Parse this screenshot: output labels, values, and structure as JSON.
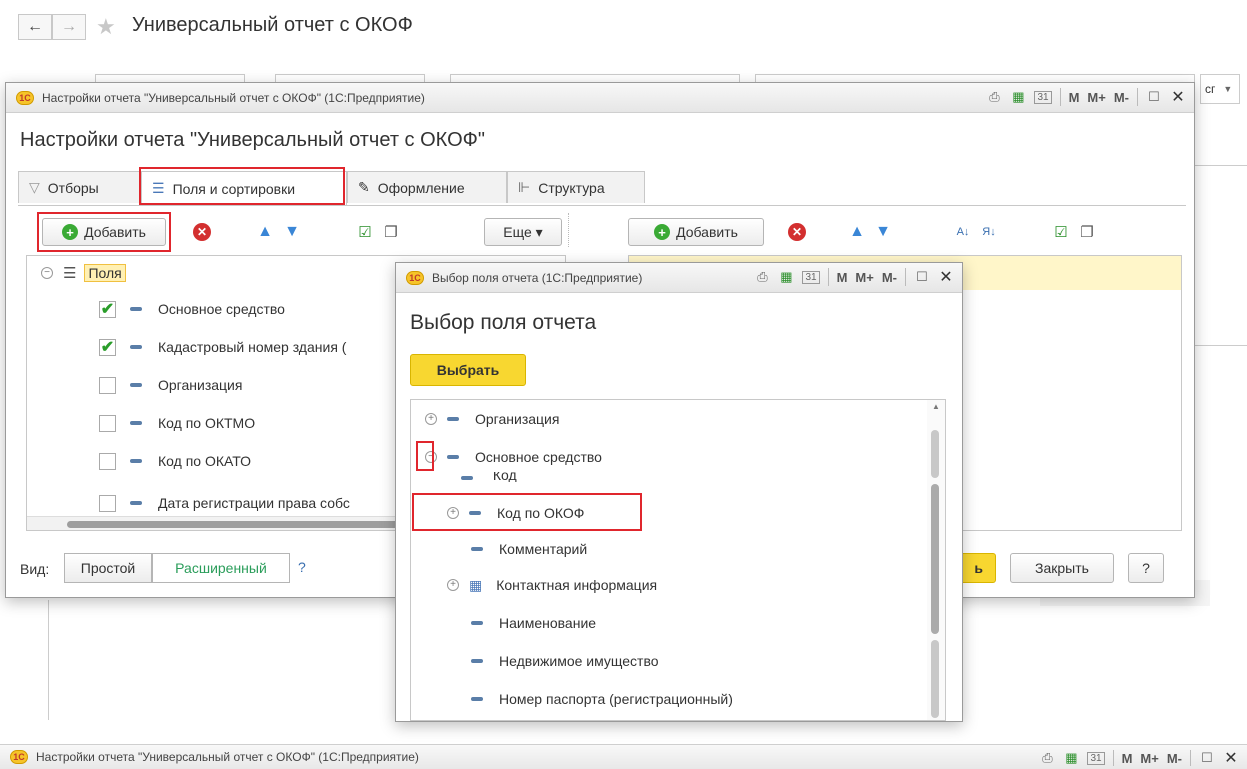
{
  "main_window": {
    "title": "Универсальный отчет с ОКОФ",
    "back_icon": "←",
    "forward_icon": "→",
    "star_icon": "★",
    "partial_right_text": "сг"
  },
  "settings_dialog": {
    "window_title": "Настройки отчета \"Универсальный отчет с ОКОФ\"  (1С:Предприятие)",
    "heading": "Настройки отчета \"Универсальный отчет с ОКОФ\"",
    "logo_text": "1С",
    "tabs": [
      "Отборы",
      "Поля и сортировки",
      "Оформление",
      "Структура"
    ],
    "tab_icons": [
      "funnel-icon",
      "fields-sort-icon",
      "brush-icon",
      "structure-icon"
    ],
    "toolbar_left": {
      "add_label": "Добавить",
      "more_label": "Еще ▾"
    },
    "toolbar_right": {
      "add_label": "Добавить"
    },
    "fields_tree": {
      "root_label": "Поля",
      "items": [
        {
          "label": "Основное средство",
          "checked": true
        },
        {
          "label": "Кадастровый номер здания (",
          "checked": true
        },
        {
          "label": "Организация",
          "checked": false
        },
        {
          "label": "Код по ОКТМО",
          "checked": false
        },
        {
          "label": "Код по ОКАТО",
          "checked": false
        },
        {
          "label": "Дата регистрации права собс",
          "checked": false
        }
      ]
    },
    "footer": {
      "view_label": "Вид:",
      "simple_label": "Простой",
      "extended_label": "Расширенный",
      "help_q": "?",
      "ok_partial": "ь",
      "close_label": "Закрыть",
      "help_button": "?"
    }
  },
  "field_picker_dialog": {
    "window_title": "Выбор поля отчета  (1С:Предприятие)",
    "heading": "Выбор поля отчета",
    "select_button": "Выбрать",
    "items": [
      {
        "label": "Организация",
        "level": 0,
        "expander": "⊕"
      },
      {
        "label": "Основное средство",
        "level": 0,
        "expander": "⊖"
      },
      {
        "label": "Код",
        "level": 1,
        "expander": ""
      },
      {
        "label": "Код по ОКОФ",
        "level": 1,
        "expander": "⊕"
      },
      {
        "label": "Комментарий",
        "level": 1,
        "expander": ""
      },
      {
        "label": "Контактная информация",
        "level": 1,
        "expander": "⊕"
      },
      {
        "label": "Наименование",
        "level": 1,
        "expander": ""
      },
      {
        "label": "Недвижимое имущество",
        "level": 1,
        "expander": ""
      },
      {
        "label": "Номер паспорта (регистрационный)",
        "level": 1,
        "expander": ""
      }
    ]
  },
  "bottom_bar": {
    "title": "Настройки отчета \"Универсальный отчет с ОКОФ\"  (1С:Предприятие)"
  },
  "titlebar_icons": {
    "print": "⎙",
    "calc": "▦",
    "calendar": "31",
    "m": "M",
    "m_plus": "M+",
    "m_minus": "M-",
    "maximize": "☐",
    "close": "✕"
  },
  "colors": {
    "accent_yellow": "#f8d730",
    "highlight_red": "#e0262d",
    "green": "#3aaa35",
    "selection_yellow": "#fff6c9"
  }
}
